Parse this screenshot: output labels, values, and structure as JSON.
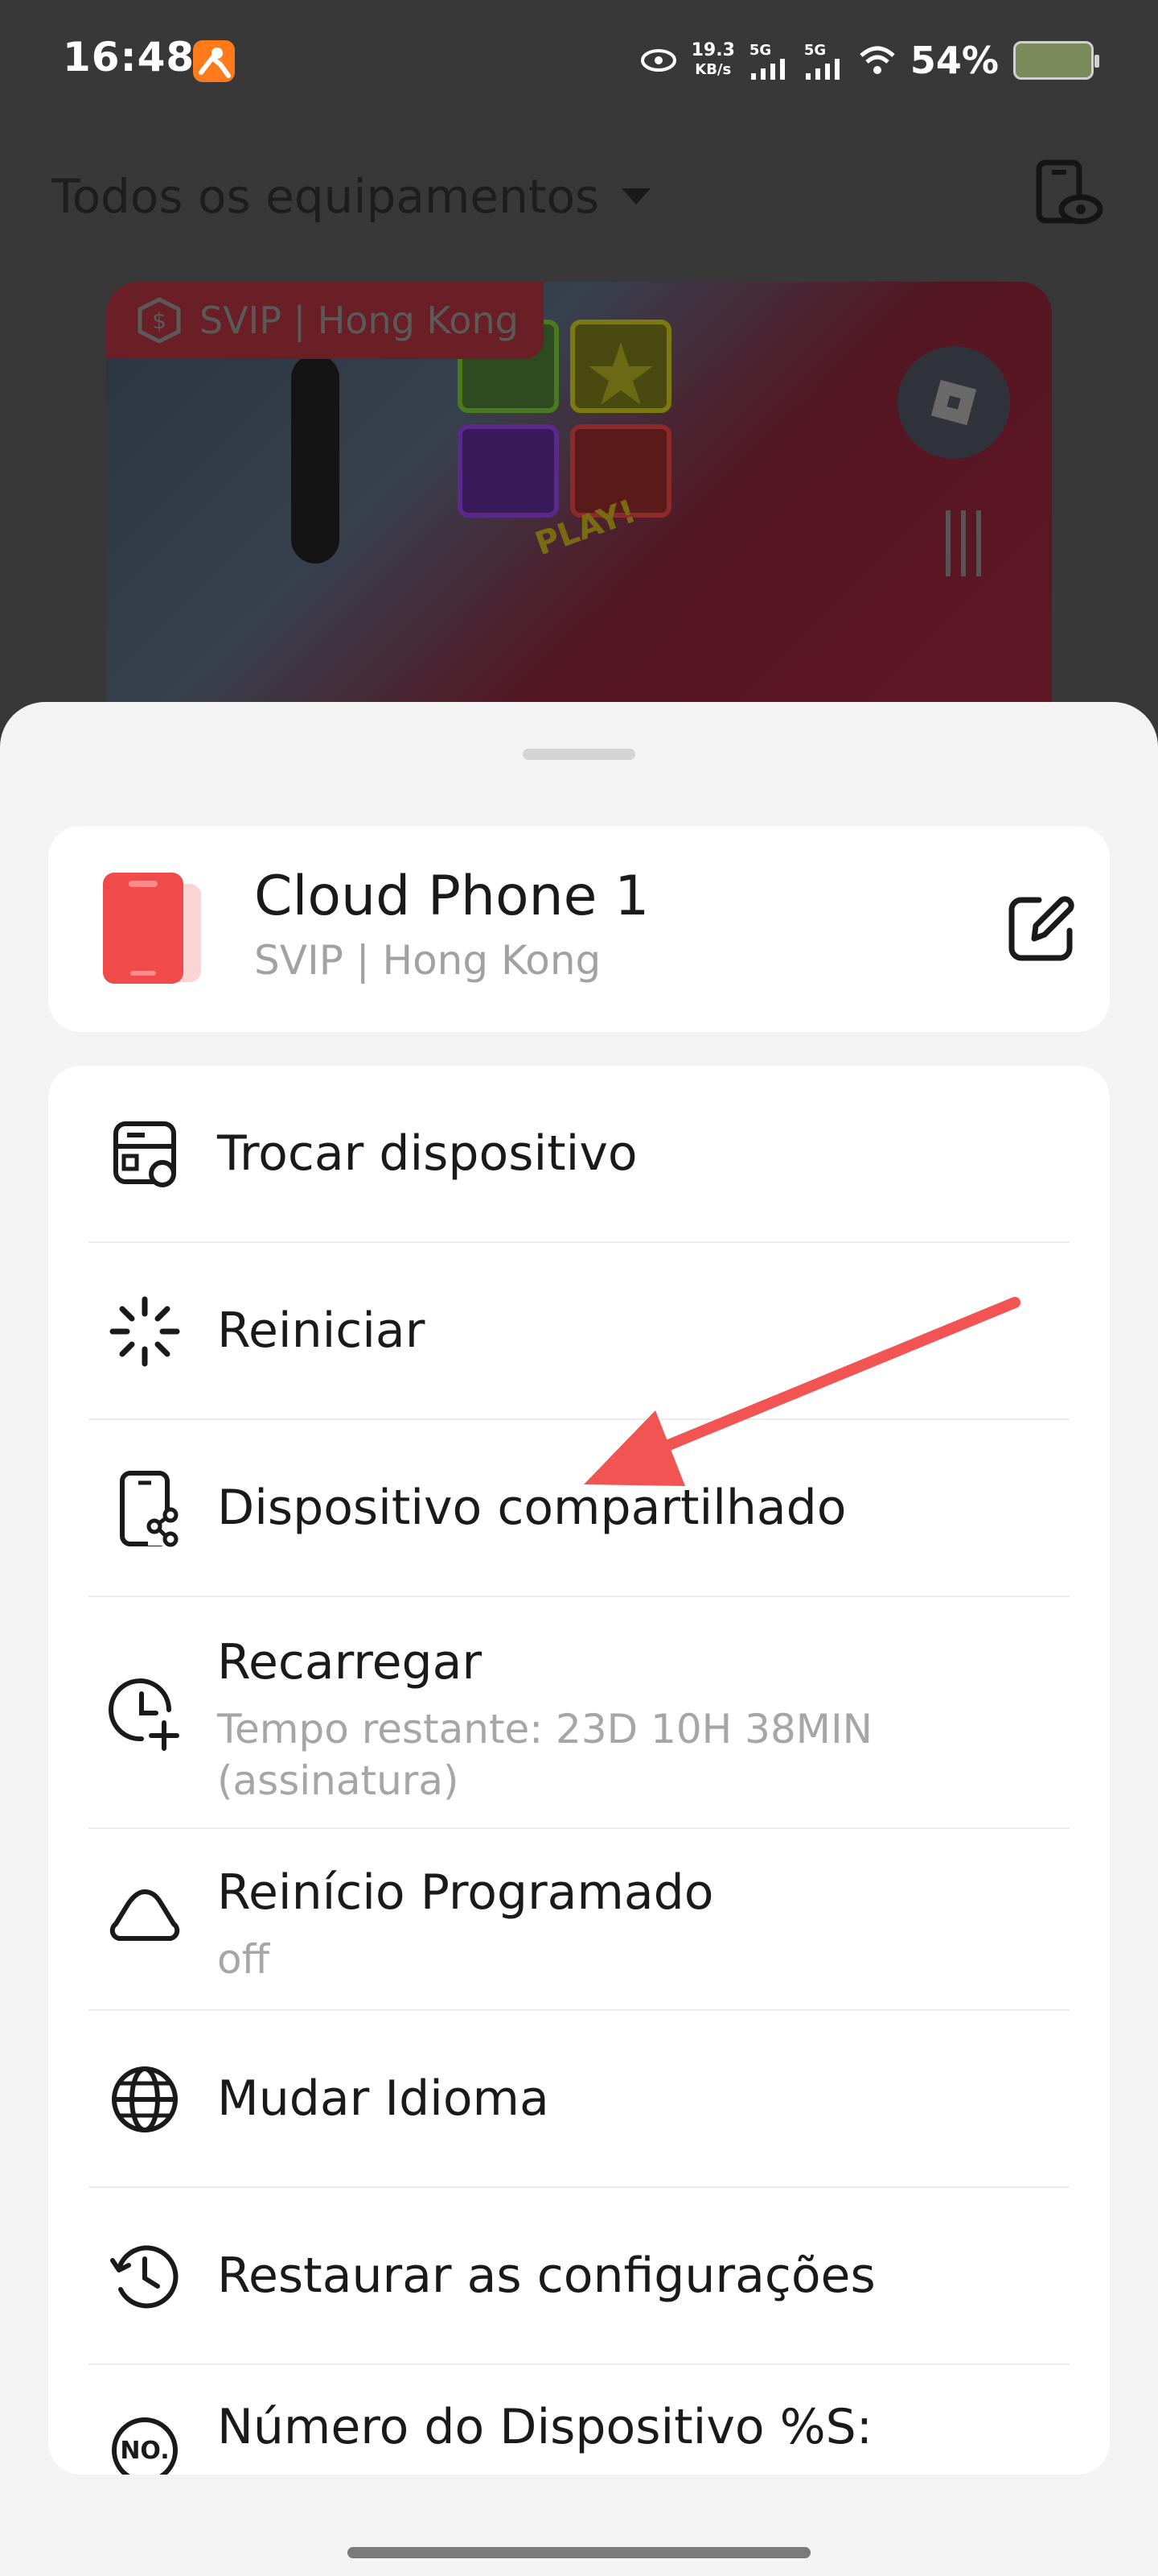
{
  "status_bar": {
    "time": "16:48",
    "net_speed_value": "19.3",
    "net_speed_unit": "KB/s",
    "sim1_label": "5G",
    "sim2_label": "5G",
    "battery_percent": "54%",
    "battery_level": 0.54
  },
  "header": {
    "title": "Todos os equipamentos"
  },
  "preview": {
    "tag_text": "SVIP | Hong Kong"
  },
  "device_card": {
    "name": "Cloud Phone 1",
    "subtitle": "SVIP | Hong Kong"
  },
  "menu": {
    "items": [
      {
        "label": "Trocar dispositivo",
        "icon": "switch-device-icon"
      },
      {
        "label": "Reiniciar",
        "icon": "restart-spinner-icon"
      },
      {
        "label": "Dispositivo compartilhado",
        "icon": "shared-device-icon"
      },
      {
        "label": "Recarregar",
        "sub": "Tempo restante: 23D 10H 38MIN (assinatura)",
        "icon": "recharge-clock-icon"
      },
      {
        "label": "Reinício Programado",
        "sub": "off",
        "icon": "scheduled-restart-icon"
      },
      {
        "label": "Mudar Idioma",
        "icon": "globe-icon"
      },
      {
        "label": "Restaurar as configurações",
        "icon": "restore-history-icon"
      },
      {
        "label": "Número do Dispositivo %S:",
        "icon": "number-badge-icon"
      }
    ]
  },
  "colors": {
    "accent_red": "#f04a4a",
    "arrow_red": "#f25353",
    "sheet_bg": "#f3f3f3",
    "overlay_bg": "#383838"
  }
}
